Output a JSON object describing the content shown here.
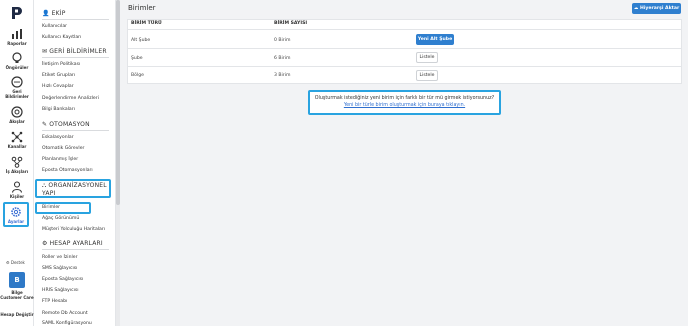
{
  "rail": {
    "items": [
      {
        "label": "Raporlar",
        "icon": "bar-chart-icon"
      },
      {
        "label": "Öngörüler",
        "icon": "lightbulb-icon"
      },
      {
        "label": "Geri Bildirimler",
        "icon": "chat-bubble-icon"
      },
      {
        "label": "Akışlar",
        "icon": "flow-icon"
      },
      {
        "label": "Kanallar",
        "icon": "channels-icon"
      },
      {
        "label": "İş Akışları",
        "icon": "workflow-icon"
      },
      {
        "label": "Kişiler",
        "icon": "person-icon"
      },
      {
        "label": "Ayarlar",
        "icon": "gear-icon"
      }
    ],
    "support": "Destek",
    "org_initial": "B",
    "org_name": "Bilge Customer Care",
    "account": "Hesap Değiştir"
  },
  "sidebar": {
    "sections": [
      {
        "title": "EKİP",
        "items": [
          "Kullanıcılar",
          "Kullanıcı Kayıtları"
        ]
      },
      {
        "title": "GERİ BİLDİRİMLER",
        "items": [
          "İletişim Politikası",
          "Etiket Grupları",
          "Hızlı Cevaplar",
          "Değerlendirme Analizleri",
          "Bilgi Bankaları"
        ]
      },
      {
        "title": "OTOMASYON",
        "items": [
          "Eskalasyonlar",
          "Otomatik Görevler",
          "Planlanmış İşler",
          "Eposta Otomasyonları"
        ]
      },
      {
        "title": "ORGANİZASYONEL YAPI",
        "items": [
          "Birimler",
          "Ağaç Görünümü",
          "Müşteri Yolculuğu Haritaları"
        ]
      },
      {
        "title": "HESAP AYARLARI",
        "items": [
          "Roller ve İzinler",
          "SMS Sağlayıcısı",
          "Eposta Sağlayıcısı",
          "HRIS Sağlayıcısı",
          "FTP Hesabı",
          "Remote Db Account",
          "SAML Konfigürasyonu"
        ]
      }
    ]
  },
  "main": {
    "title": "Birimler",
    "export_button": "Hiyerarşi Aktar",
    "columns": [
      "BİRİM TÜRÜ",
      "BİRİM SAYISI"
    ],
    "rows": [
      {
        "type": "Alt Şube",
        "count": "0 Birim",
        "action": "Yeni Alt Şube"
      },
      {
        "type": "Şube",
        "count": "6 Birim",
        "action": "Listele"
      },
      {
        "type": "Bölge",
        "count": "3 Birim",
        "action": "Listele"
      }
    ],
    "callout_question": "Oluşturmak istediğiniz yeni birim için farklı bir tür mü girmek istiyorsunuz?",
    "callout_link": "Yeni bir türle birim oluşturmak için buraya tıklayın."
  },
  "colors": {
    "accent": "#2f7fcf",
    "highlight": "#29a3e0"
  }
}
